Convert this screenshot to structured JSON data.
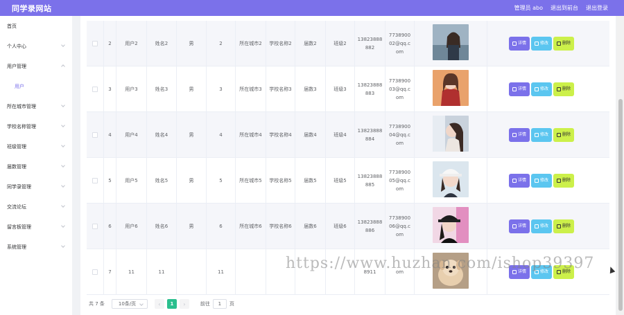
{
  "header": {
    "site_title": "同学录网站",
    "admin_label": "管理员 abo",
    "exit_to_backend": "退出到前台",
    "logout": "退出登录",
    "accent_color": "#7b71ea"
  },
  "sidebar": {
    "items": [
      {
        "label": "首页",
        "chevron": false
      },
      {
        "label": "个人中心",
        "chevron": true
      },
      {
        "label": "用户管理",
        "chevron": true,
        "expanded": true
      },
      {
        "label": "用户",
        "sub": true,
        "active": true
      },
      {
        "label": "所在城市管理",
        "chevron": true
      },
      {
        "label": "学校名称管理",
        "chevron": true
      },
      {
        "label": "班级管理",
        "chevron": true
      },
      {
        "label": "届数管理",
        "chevron": true
      },
      {
        "label": "同学录管理",
        "chevron": true
      },
      {
        "label": "交流论坛",
        "chevron": true
      },
      {
        "label": "留言板管理",
        "chevron": true
      },
      {
        "label": "系统管理",
        "chevron": true
      }
    ]
  },
  "table": {
    "buttons": {
      "detail": "详情",
      "edit": "修改",
      "delete": "删除"
    },
    "rows": [
      {
        "no": "2",
        "account": "用户2",
        "name": "姓名2",
        "gender": "男",
        "age": "2",
        "city": "所在城市2",
        "school": "学校名称2",
        "session": "届数2",
        "class": "班级2",
        "phone": "13823888882",
        "email": "773890002@qq.com",
        "photo": "woman-by-sea"
      },
      {
        "no": "3",
        "account": "用户3",
        "name": "姓名3",
        "gender": "男",
        "age": "3",
        "city": "所在城市3",
        "school": "学校名称3",
        "session": "届数3",
        "class": "班级3",
        "phone": "13823888883",
        "email": "773890003@qq.com",
        "photo": "woman-red-shirt"
      },
      {
        "no": "4",
        "account": "用户4",
        "name": "姓名4",
        "gender": "男",
        "age": "4",
        "city": "所在城市4",
        "school": "学校名称4",
        "session": "届数4",
        "class": "班级4",
        "phone": "13823888884",
        "email": "773890004@qq.com",
        "photo": "woman-profile"
      },
      {
        "no": "5",
        "account": "用户5",
        "name": "姓名5",
        "gender": "男",
        "age": "5",
        "city": "所在城市5",
        "school": "学校名称5",
        "session": "届数5",
        "class": "班级5",
        "phone": "13823888885",
        "email": "773890005@qq.com",
        "photo": "woman-white-cap"
      },
      {
        "no": "6",
        "account": "用户6",
        "name": "姓名6",
        "gender": "男",
        "age": "6",
        "city": "所在城市6",
        "school": "学校名称6",
        "session": "届数6",
        "class": "班级6",
        "phone": "13823888886",
        "email": "773890006@qq.com",
        "photo": "woman-black-cap"
      },
      {
        "no": "7",
        "account": "11",
        "name": "11",
        "gender": "",
        "age": "11",
        "city": "",
        "school": "",
        "session": "",
        "class": "",
        "phone": "8911",
        "email": "om",
        "photo": "puppy"
      }
    ]
  },
  "pagination": {
    "total": "共 7 条",
    "page_size": "10条/页",
    "prev": "‹",
    "current_page": "1",
    "next": "›",
    "goto_label": "前往",
    "goto_value": "1",
    "page_suffix": "页"
  },
  "watermark": "https://www.huzhan.com/ishop39397"
}
